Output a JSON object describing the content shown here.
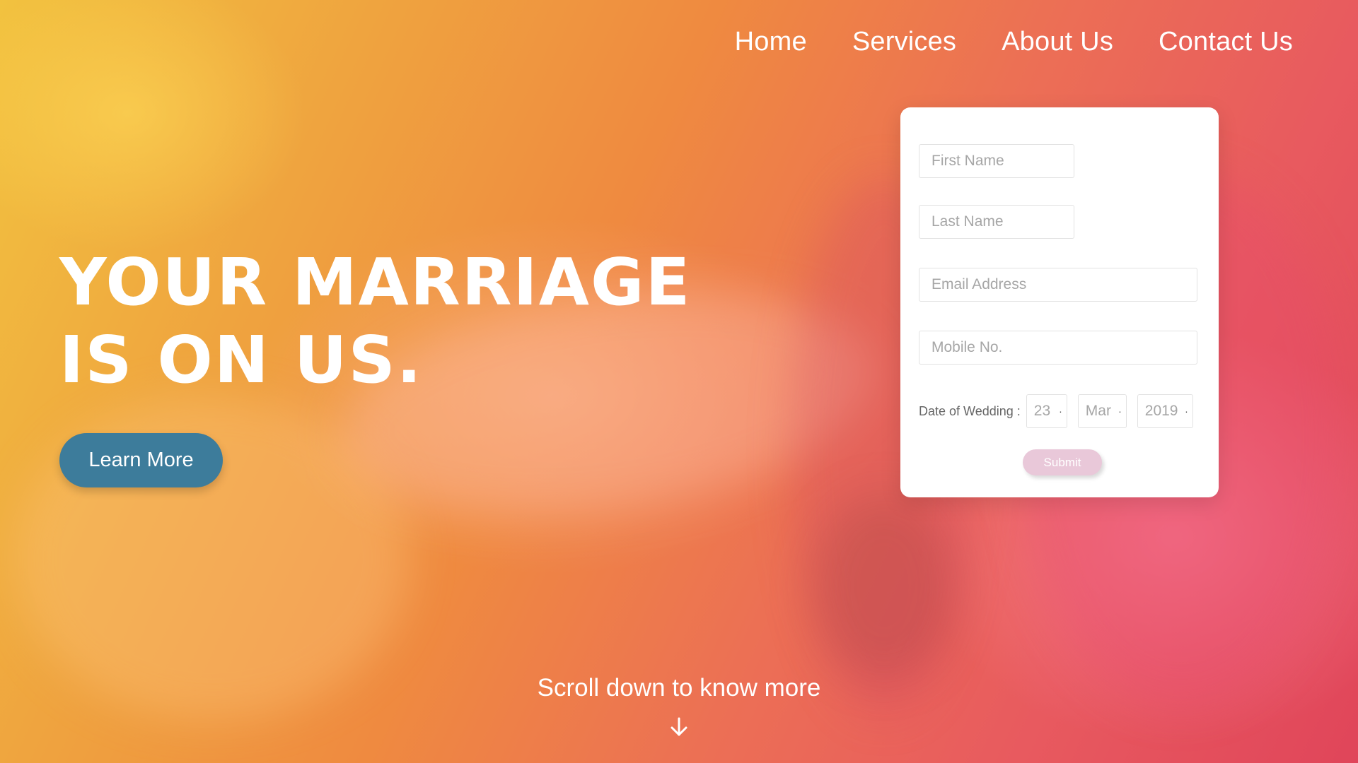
{
  "nav": {
    "items": [
      {
        "label": "Home"
      },
      {
        "label": "Services"
      },
      {
        "label": "About Us"
      },
      {
        "label": "Contact Us"
      }
    ]
  },
  "hero": {
    "headline_line1": "YOUR MARRIAGE",
    "headline_line2": "IS ON US.",
    "cta_label": "Learn More",
    "scroll_text": "Scroll down to know more",
    "scroll_icon": "arrow-down-icon"
  },
  "form": {
    "first_name_placeholder": "First Name",
    "last_name_placeholder": "Last Name",
    "email_placeholder": "Email Address",
    "mobile_placeholder": "Mobile No.",
    "date_label": "Date of Wedding :",
    "day": "23",
    "month": "Mar",
    "year": "2019",
    "submit_label": "Submit"
  },
  "colors": {
    "cta_bg": "#3d7c9b",
    "submit_bg": "#e9c8d9",
    "gradient_start": "#f2c23f",
    "gradient_end": "#e0455a"
  }
}
